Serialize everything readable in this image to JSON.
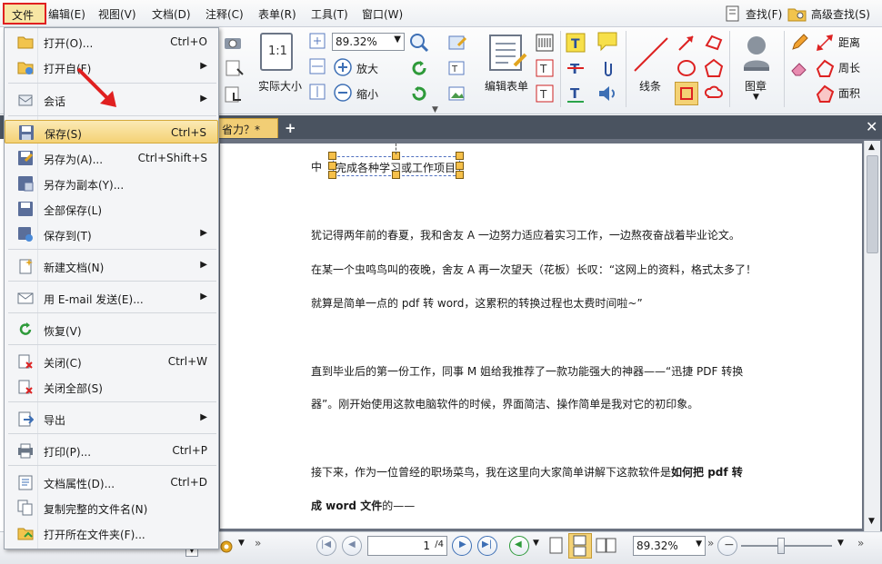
{
  "menubar": {
    "items": [
      "文件",
      "编辑(E)",
      "视图(V)",
      "文档(D)",
      "注释(C)",
      "表单(R)",
      "工具(T)",
      "窗口(W)"
    ],
    "search_label": "查找(F)",
    "advanced_search_label": "高级查找(S)"
  },
  "ribbon": {
    "zoom_value": "89.32%",
    "actual_size_label": "实际大小",
    "zoom_in_label": "放大",
    "zoom_out_label": "缩小",
    "edit_form_label": "编辑表单",
    "line_label": "线条",
    "stamp_label": "图章",
    "distance_label": "距离",
    "perimeter_label": "周长",
    "area_label": "面积",
    "doc_tab_label": "省力？*"
  },
  "file_menu": {
    "items": [
      {
        "label": "打开(O)...",
        "shortcut": "Ctrl+O",
        "submenu": false
      },
      {
        "label": "打开自(F)",
        "shortcut": "",
        "submenu": true
      },
      {
        "label": "会话",
        "shortcut": "",
        "submenu": true
      },
      {
        "label": "保存(S)",
        "shortcut": "Ctrl+S",
        "submenu": false
      },
      {
        "label": "另存为(A)...",
        "shortcut": "Ctrl+Shift+S",
        "submenu": false
      },
      {
        "label": "另存为副本(Y)...",
        "shortcut": "",
        "submenu": false
      },
      {
        "label": "全部保存(L)",
        "shortcut": "",
        "submenu": false
      },
      {
        "label": "保存到(T)",
        "shortcut": "",
        "submenu": true
      },
      {
        "label": "新建文档(N)",
        "shortcut": "",
        "submenu": true
      },
      {
        "label": "用 E-mail 发送(E)...",
        "shortcut": "",
        "submenu": true
      },
      {
        "label": "恢复(V)",
        "shortcut": "",
        "submenu": false
      },
      {
        "label": "关闭(C)",
        "shortcut": "Ctrl+W",
        "submenu": false
      },
      {
        "label": "关闭全部(S)",
        "shortcut": "",
        "submenu": false
      },
      {
        "label": "导出",
        "shortcut": "",
        "submenu": true
      },
      {
        "label": "打印(P)...",
        "shortcut": "Ctrl+P",
        "submenu": false
      },
      {
        "label": "文档属性(D)...",
        "shortcut": "Ctrl+D",
        "submenu": false
      },
      {
        "label": "复制完整的文件名(N)",
        "shortcut": "",
        "submenu": false
      },
      {
        "label": "打开所在文件夹(F)...",
        "shortcut": "",
        "submenu": false
      }
    ],
    "arrow": "▶"
  },
  "document": {
    "title_prefix": "中",
    "selected_text": "完成各种学习或工作项目",
    "paragraphs": [
      "犹记得两年前的春夏，我和舍友 A 一边努力适应着实习工作，一边熬夜奋战着毕业论文。",
      "在某一个虫鸣鸟叫的夜晚，舍友 A 再一次望天（花板）长叹：“这网上的资料，格式太多了！",
      "就算是简单一点的 pdf 转 word，这累积的转换过程也太费时间啦~”",
      "直到毕业后的第一份工作，同事 M 姐给我推荐了一款功能强大的神器——“迅捷 PDF 转换",
      "器”。刚开始使用这款电脑软件的时候，界面简洁、操作简单是我对它的初印象。",
      "接下来，作为一位曾经的职场菜鸟，我在这里向大家简单讲解下这款软件是",
      "如何把 pdf 转",
      "成 word 文件",
      "的——"
    ]
  },
  "statusbar": {
    "page_current": "1",
    "page_total": "/4",
    "zoom": "89.32%"
  },
  "colors": {
    "accent_red": "#e02020",
    "highlight": "#f4d275"
  }
}
